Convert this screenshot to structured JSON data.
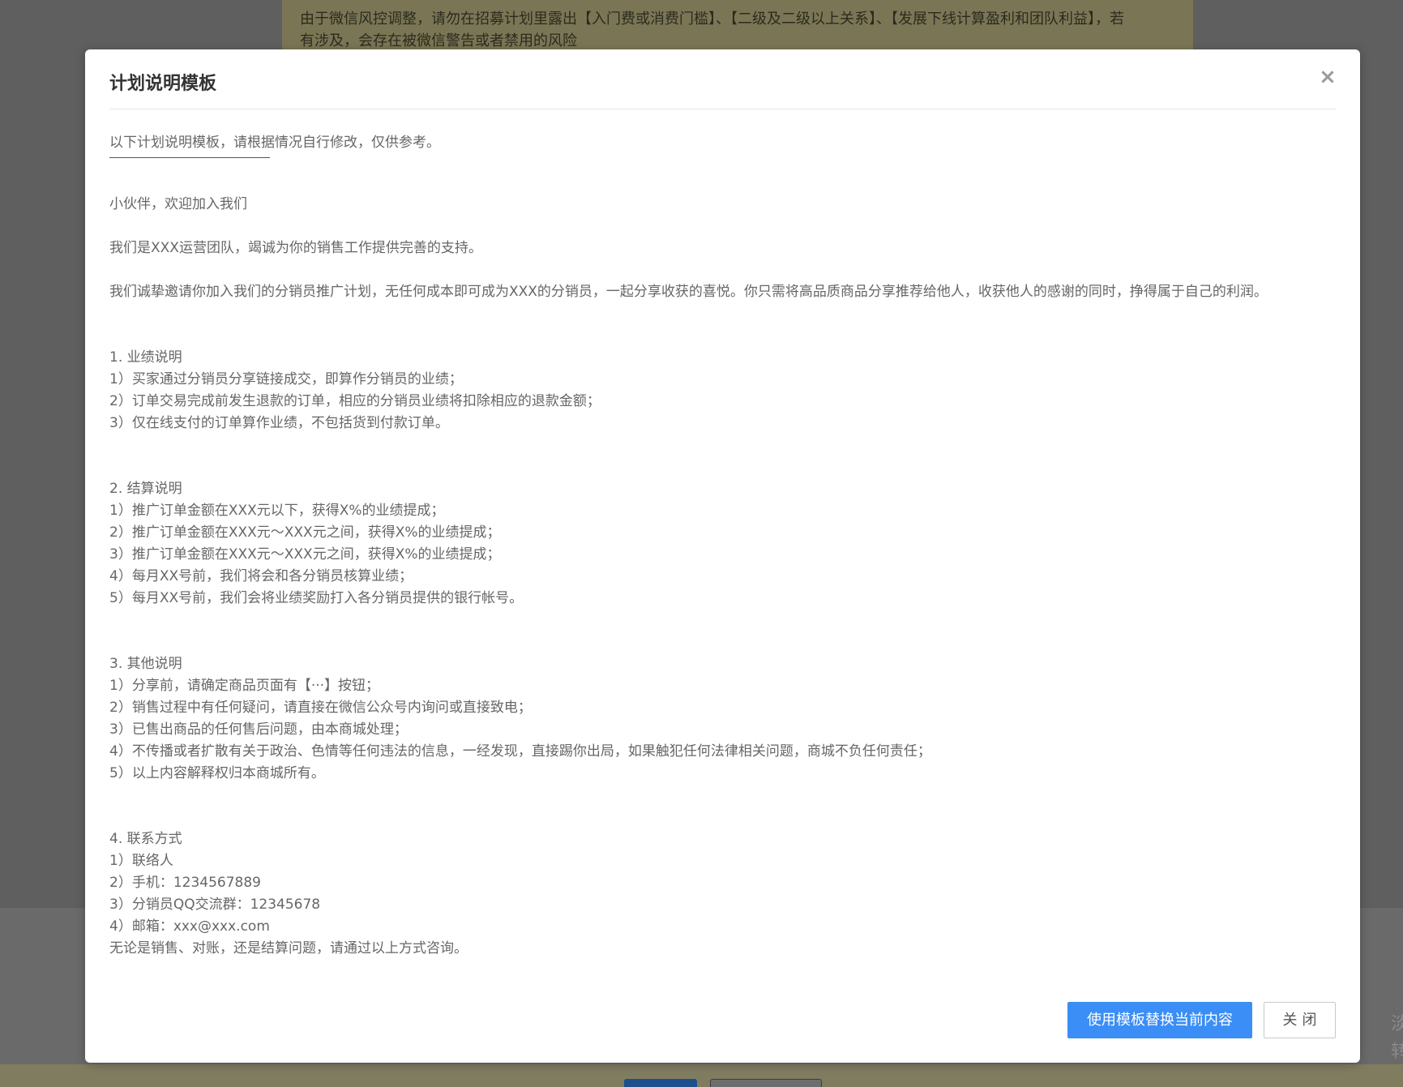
{
  "background": {
    "notice_line1": "由于微信风控调整，请勿在招募计划里露出【入门费或消费门槛】、【二级及二级以上关系】、【发展下线计算盈利和团队利益】，若",
    "notice_line2": "有涉及，会存在被微信警告或者禁用的风险",
    "side_text_1": "淡",
    "side_text_2": "转"
  },
  "modal": {
    "title": "计划说明模板",
    "close_symbol": "×",
    "intro": "以下计划说明模板，请根据情况自行修改，仅供参考。",
    "greeting": "小伙伴，欢迎加入我们",
    "team_line": "我们是XXX运营团队，竭诚为你的销售工作提供完善的支持。",
    "invite_line": "我们诚挚邀请你加入我们的分销员推广计划，无任何成本即可成为XXX的分销员，一起分享收获的喜悦。你只需将高品质商品分享推荐给他人，收获他人的感谢的同时，挣得属于自己的利润。",
    "sections": [
      {
        "heading": "1. 业绩说明",
        "items": [
          "1）买家通过分销员分享链接成交，即算作分销员的业绩；",
          "2）订单交易完成前发生退款的订单，相应的分销员业绩将扣除相应的退款金额；",
          "3）仅在线支付的订单算作业绩，不包括货到付款订单。"
        ]
      },
      {
        "heading": "2. 结算说明",
        "items": [
          "1）推广订单金额在XXX元以下，获得X%的业绩提成；",
          "2）推广订单金额在XXX元～XXX元之间，获得X%的业绩提成；",
          "3）推广订单金额在XXX元～XXX元之间，获得X%的业绩提成；",
          "4）每月XX号前，我们将会和各分销员核算业绩；",
          "5）每月XX号前，我们会将业绩奖励打入各分销员提供的银行帐号。"
        ]
      },
      {
        "heading": "3. 其他说明",
        "items": [
          "1）分享前，请确定商品页面有【···】按钮；",
          "2）销售过程中有任何疑问，请直接在微信公众号内询问或直接致电；",
          "3）已售出商品的任何售后问题，由本商城处理；",
          "4）不传播或者扩散有关于政治、色情等任何违法的信息，一经发现，直接踢你出局，如果触犯任何法律相关问题，商城不负任何责任；",
          "5）以上内容解释权归本商城所有。"
        ]
      },
      {
        "heading": "4. 联系方式",
        "items": [
          "1）联络人",
          "2）手机：1234567889",
          "3）分销员QQ交流群：12345678",
          "4）邮箱：xxx@xxx.com",
          "无论是销售、对账，还是结算问题，请通过以上方式咨询。"
        ]
      }
    ],
    "buttons": {
      "apply_label": "使用模板替换当前内容",
      "close_label": "关闭"
    }
  },
  "colors": {
    "primary_button": "#3a8ef6",
    "body_text": "#666666",
    "title_text": "#333333"
  }
}
